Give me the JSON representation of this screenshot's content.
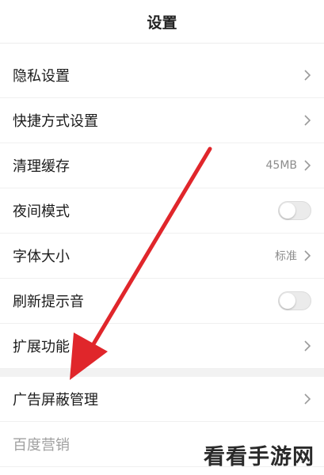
{
  "header": {
    "title": "设置"
  },
  "items_group1": [
    {
      "label": "隐私设置",
      "value": "",
      "control": "chevron"
    },
    {
      "label": "快捷方式设置",
      "value": "",
      "control": "chevron"
    },
    {
      "label": "清理缓存",
      "value": "45MB",
      "control": "chevron"
    },
    {
      "label": "夜间模式",
      "value": "",
      "control": "toggle",
      "toggle_on": false
    },
    {
      "label": "字体大小",
      "value": "标准",
      "control": "chevron"
    },
    {
      "label": "刷新提示音",
      "value": "",
      "control": "toggle",
      "toggle_on": false
    },
    {
      "label": "扩展功能",
      "value": "",
      "control": "chevron"
    }
  ],
  "items_group2": [
    {
      "label": "广告屏蔽管理",
      "value": "",
      "control": "chevron"
    },
    {
      "label": "百度营销",
      "value": "",
      "control": "none"
    }
  ],
  "annotation": {
    "arrow_color": "#e0262b"
  },
  "watermark": {
    "text": "看看手游网"
  }
}
